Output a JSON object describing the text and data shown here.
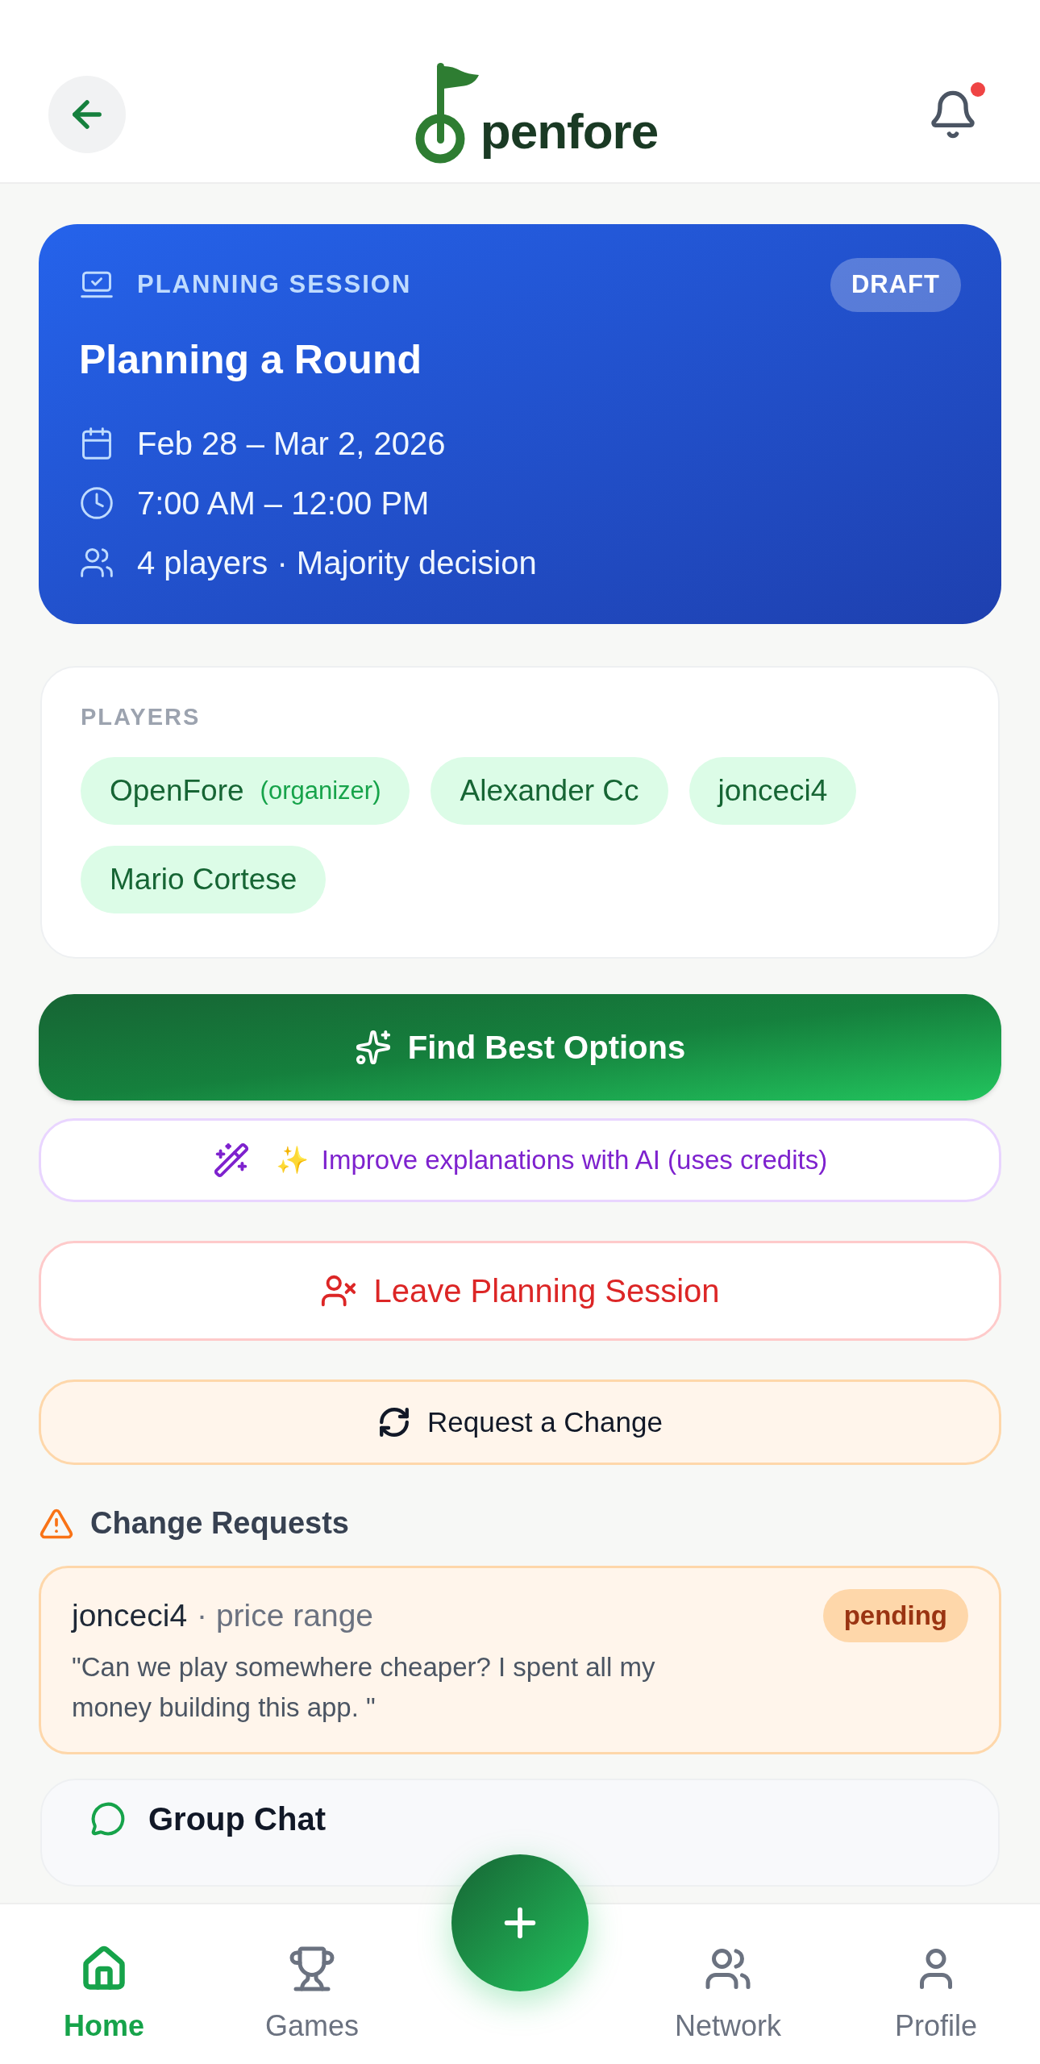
{
  "header": {
    "logo_text": "penfore",
    "notification_unread": true
  },
  "session": {
    "eyebrow": "PLANNING SESSION",
    "badge": "DRAFT",
    "title": "Planning a Round",
    "details": [
      {
        "kind": "date",
        "text": "Feb 28 – Mar 2, 2026"
      },
      {
        "kind": "time",
        "text": "7:00 AM – 12:00 PM"
      },
      {
        "kind": "players",
        "text": "4 players · Majority decision"
      }
    ]
  },
  "players": {
    "heading": "PLAYERS",
    "items": [
      {
        "name": "OpenFore",
        "role": "(organizer)"
      },
      {
        "name": "Alexander Cc"
      },
      {
        "name": "jonceci4"
      },
      {
        "name": "Mario Cortese"
      }
    ]
  },
  "actions": [
    {
      "kind": "primary",
      "label": "Find Best Options"
    },
    {
      "kind": "ai",
      "emoji": "✨",
      "label": "Improve explanations with AI (uses credits)"
    },
    {
      "kind": "danger",
      "label": "Leave Planning Session"
    },
    {
      "kind": "request",
      "label": "Request a Change"
    }
  ],
  "change_requests": {
    "heading": "Change Requests",
    "items": [
      {
        "user": "jonceci4",
        "topic": "· price range",
        "status": "pending",
        "message": "\"Can we play somewhere cheaper? I spent all my money building this app. \""
      }
    ]
  },
  "group_chat": {
    "title": "Group Chat"
  },
  "nav": [
    {
      "kind": "home",
      "label": "Home",
      "selected": true
    },
    {
      "kind": "games",
      "label": "Games",
      "selected": false
    },
    {
      "kind": "add"
    },
    {
      "kind": "network",
      "label": "Network",
      "selected": false
    },
    {
      "kind": "profile",
      "label": "Profile",
      "selected": false
    }
  ]
}
